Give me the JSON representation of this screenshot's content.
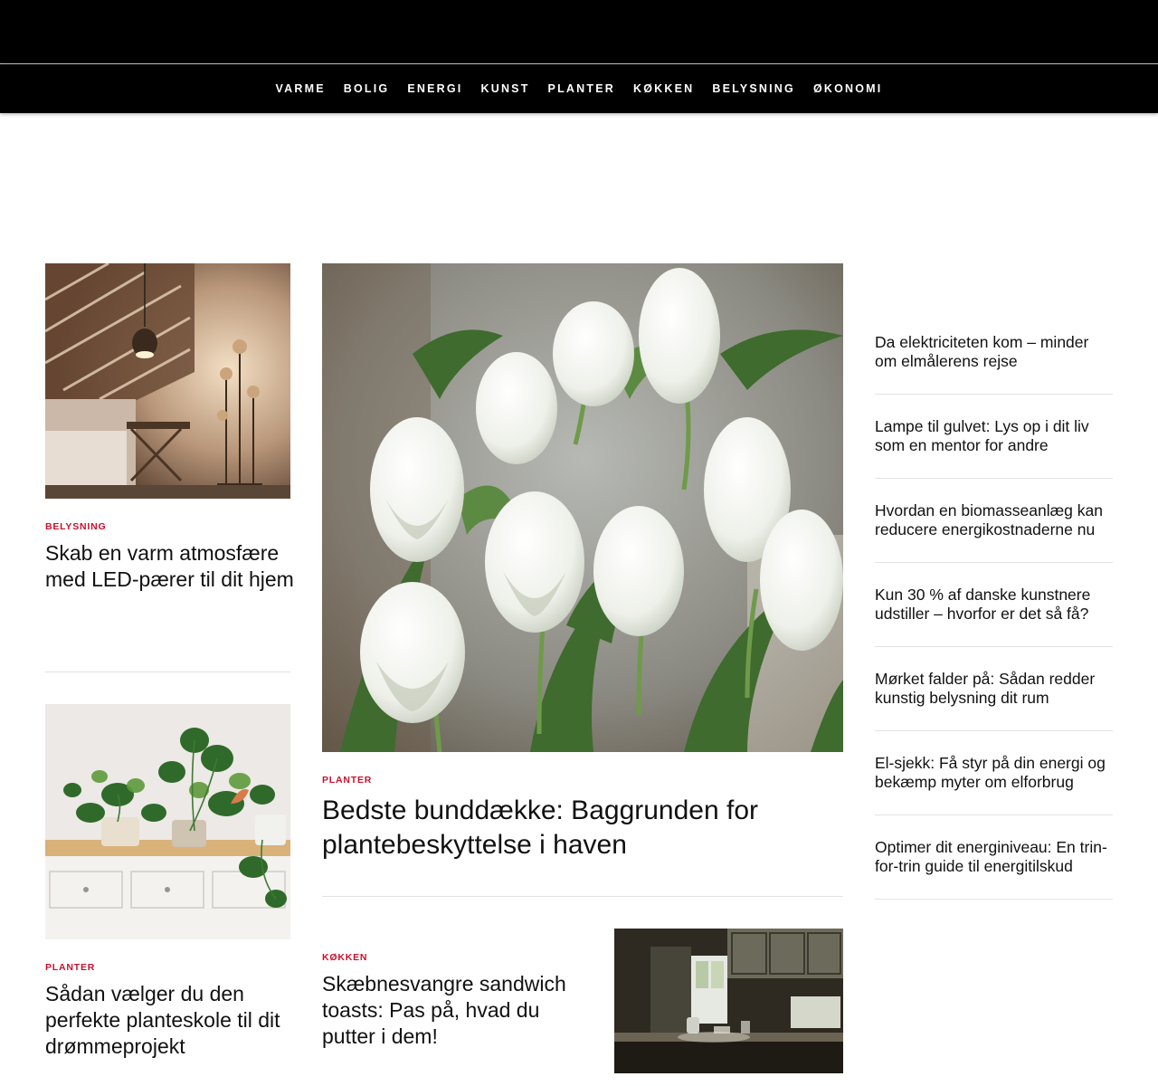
{
  "nav": {
    "items": [
      "VARME",
      "BOLIG",
      "ENERGI",
      "KUNST",
      "PLANTER",
      "KØKKEN",
      "BELYSNING",
      "ØKONOMI"
    ]
  },
  "articles": {
    "left_top": {
      "category": "BELYSNING",
      "title": "Skab en varm atmosfære med LED-pærer til dit hjem"
    },
    "left_bottom": {
      "category": "PLANTER",
      "title": "Sådan vælger du den perfekte planteskole til dit drømmeprojekt"
    },
    "featured": {
      "category": "PLANTER",
      "title": "Bedste bunddække: Baggrunden for plantebeskyttelse i haven"
    },
    "center_bottom": {
      "category": "KØKKEN",
      "title": "Skæbnesvangre sandwich toasts: Pas på, hvad du putter i dem!"
    }
  },
  "sidebar": {
    "items": [
      "Da elektriciteten kom – minder om elmålerens rejse",
      "Lampe til gulvet: Lys op i dit liv som en mentor for andre",
      "Hvordan en biomasseanlæg kan reducere energikostnaderne nu",
      "Kun 30 % af danske kunstnere udstiller – hvorfor er det så få?",
      "Mørket falder på: Sådan redder kunstig belysning dit rum",
      "El-sjekk: Få styr på din energi og bekæmp myter om elforbrug",
      "Optimer dit energiniveau: En trin-for-trin guide til energitilskud"
    ]
  },
  "colors": {
    "accent": "#c8102e",
    "header_bg": "#000000"
  }
}
